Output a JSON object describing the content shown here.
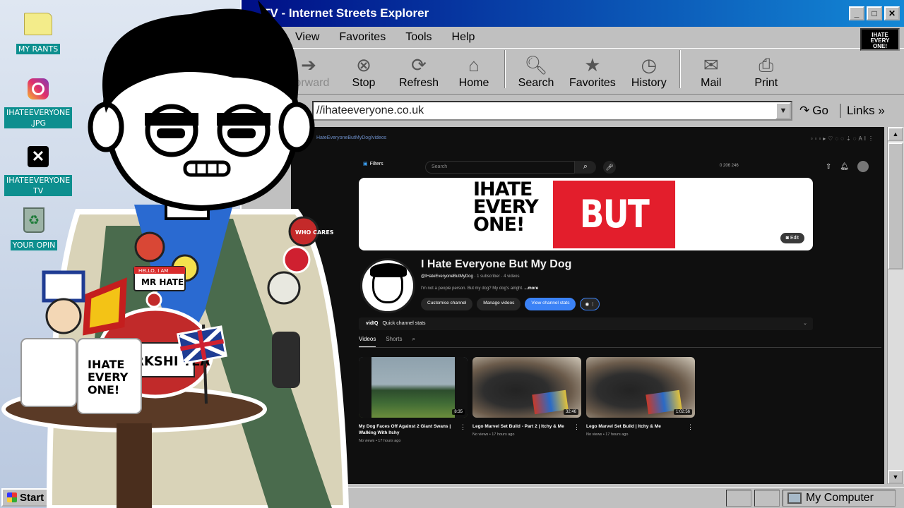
{
  "desktop": {
    "icons": [
      {
        "name": "my-rants-folder",
        "label": "MY RANTS"
      },
      {
        "name": "instagram-shortcut",
        "label": "IHATEEVERYONE\n.JPG"
      },
      {
        "name": "x-shortcut",
        "label": "IHATEEVERYONE\nTV"
      },
      {
        "name": "recycle-bin",
        "label": "YOUR OPIN"
      }
    ]
  },
  "window": {
    "title": "TV - Internet Streets Explorer",
    "menu": [
      "View",
      "Favorites",
      "Tools",
      "Help"
    ],
    "brand_lines": [
      "IHATE",
      "EVERY",
      "ONE!"
    ],
    "toolbar": {
      "forward": "Forward",
      "stop": "Stop",
      "refresh": "Refresh",
      "home": "Home",
      "search": "Search",
      "favorites": "Favorites",
      "history": "History",
      "mail": "Mail",
      "print": "Print"
    },
    "address": "//ihateeveryone.co.uk",
    "go": "Go",
    "links": "Links",
    "status_right": "My Computer"
  },
  "youtube": {
    "url_mini": "HateEveryoneButMyDog/videos",
    "filters": "Filters",
    "search_placeholder": "Search",
    "top_stats": "0  206  246",
    "banner": {
      "left_text": "IHATE EVERY ONE!",
      "right_text": "BUT MY DOG",
      "edit": "Edit"
    },
    "channel": {
      "name": "I Hate Everyone But My Dog",
      "handle": "@IHateEveryoneButMyDog",
      "meta": " · 1 subscriber · 4 videos",
      "description": "I'm not a people person. But my dog? My dog's alright. ",
      "more": "...more",
      "btn_customise": "Customise channel",
      "btn_manage": "Manage videos",
      "btn_stats": "View channel stats"
    },
    "vidiq": {
      "brand": "vidIQ",
      "label": "Quick channel stats"
    },
    "tabs": [
      "Videos",
      "Shorts"
    ],
    "videos": [
      {
        "title": "My Dog Faces Off Against 2 Giant Swans | Walking With Itchy",
        "meta": "No views • 17 hours ago",
        "duration": "8:35"
      },
      {
        "title": "Lego Marvel Set Build - Part 2 | Itchy & Me",
        "meta": "No views • 17 hours ago",
        "duration": "32:46"
      },
      {
        "title": "Lego Marvel Set Build | Itchy & Me",
        "meta": "No views • 17 hours ago",
        "duration": "1:02:56"
      }
    ]
  },
  "character": {
    "name_badge_top": "HELLO, I AM",
    "name_badge": "MR HATE",
    "mug_text": [
      "IHATE",
      "EVERY",
      "ONE!"
    ],
    "tea_label": "RKSHI TEA",
    "patch_who": "WHO CARES"
  },
  "taskbar": {
    "start": "Start"
  }
}
